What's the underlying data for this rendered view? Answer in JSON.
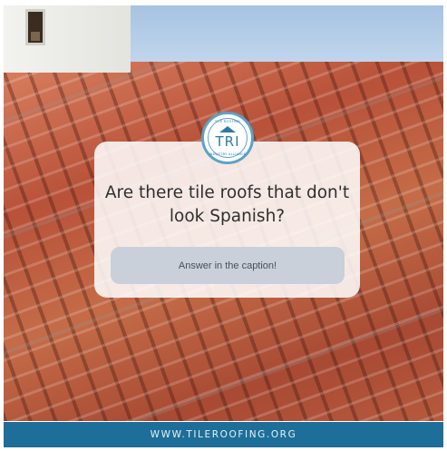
{
  "logo": {
    "initials": "TRI",
    "ring_top_text": "TILE ROOFING",
    "ring_bottom_text": "INDUSTRY ALLIANCE",
    "icon": "roof-icon",
    "accent_color": "#2b7aa6"
  },
  "card": {
    "question": "Are there tile roofs that don't look Spanish?",
    "answer_prompt": "Answer in the caption!"
  },
  "footer": {
    "website": "WWW.TILEROOFING.ORG",
    "background_color": "#1d6f99"
  }
}
